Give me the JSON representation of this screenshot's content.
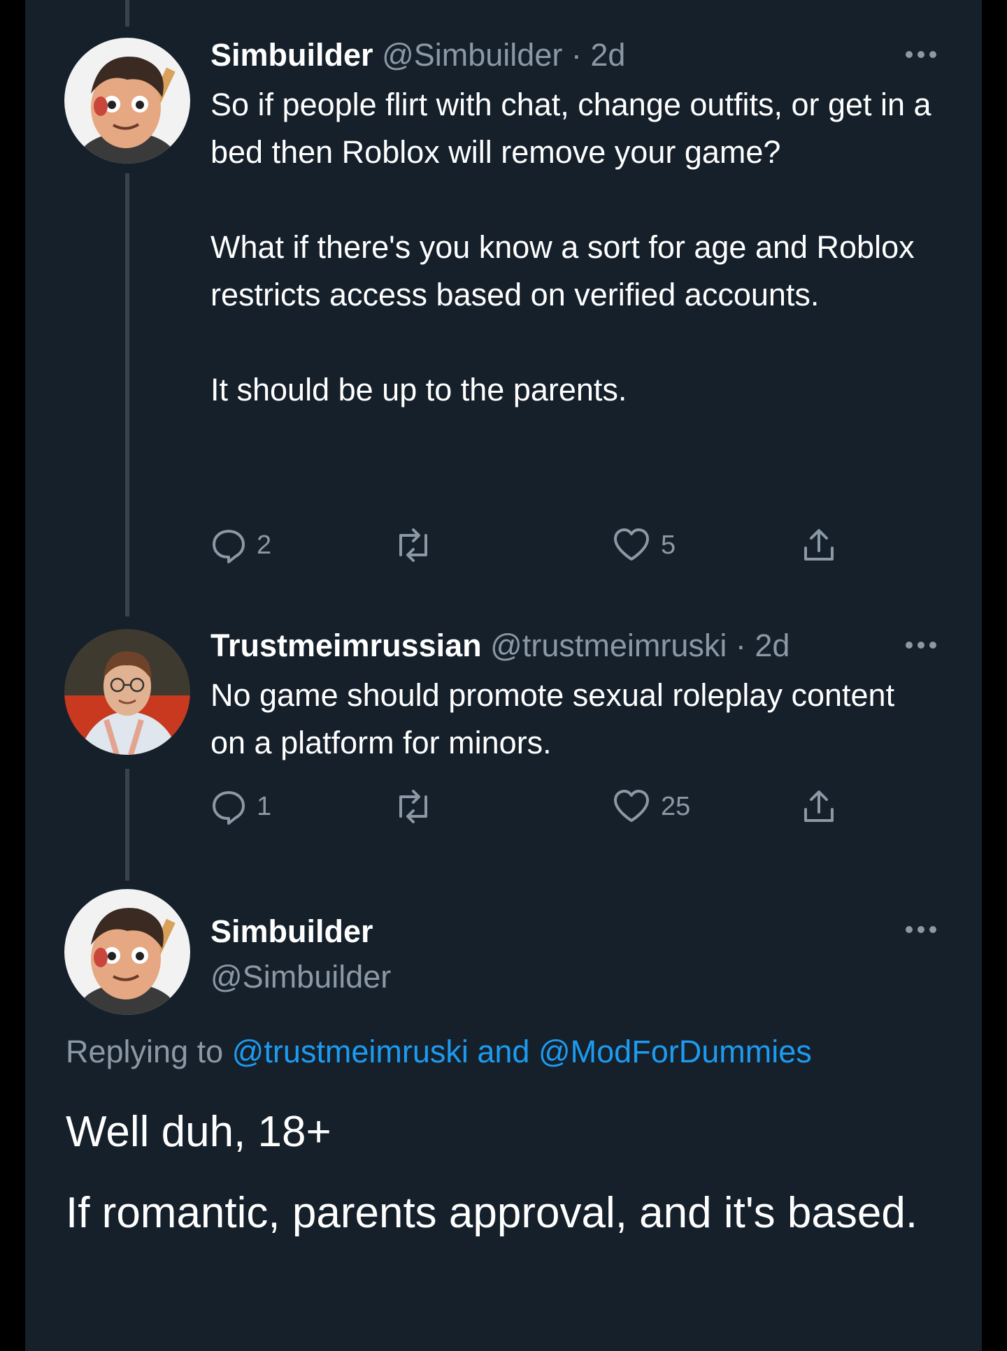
{
  "tweets": [
    {
      "name": "Simbuilder",
      "handle": "@Simbuilder",
      "time": "2d",
      "paragraphs": [
        "So if people flirt with chat, change outfits, or get in a bed then Roblox will remove your game?",
        "What if there's you know a sort for age and Roblox restricts access based on verified accounts.",
        "It should be up to the parents."
      ],
      "replies": "2",
      "retweets": "",
      "likes": "5"
    },
    {
      "name": "Trustmeimrussian",
      "handle": "@trustmeimruski",
      "time": "2d",
      "paragraphs": [
        "No game should promote sexual roleplay content on a platform for minors."
      ],
      "replies": "1",
      "retweets": "",
      "likes": "25"
    }
  ],
  "main_tweet": {
    "name": "Simbuilder",
    "handle": "@Simbuilder",
    "replying_prefix": "Replying to",
    "replying_user1": "@trustmeimruski",
    "replying_and": "and",
    "replying_user2": "@ModForDummies",
    "paragraphs": [
      "Well duh, 18+",
      "If romantic, parents approval, and it's based."
    ]
  },
  "separator": "·",
  "icons": [
    "more-icon",
    "reply-icon",
    "retweet-icon",
    "like-icon",
    "share-icon"
  ],
  "colors": {
    "background": "#15202b",
    "text": "#ffffff",
    "secondary": "#8b98a5",
    "link": "#1d9bf0",
    "thread_line": "#38444d"
  }
}
